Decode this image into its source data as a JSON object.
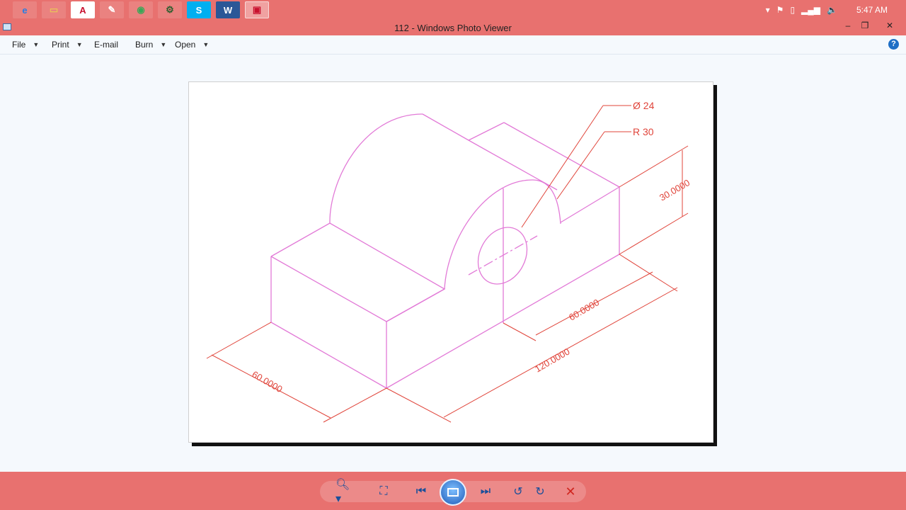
{
  "window": {
    "title": "112 - Windows Photo Viewer"
  },
  "taskbar": {
    "apps": [
      {
        "name": "internet-explorer",
        "glyph": "e"
      },
      {
        "name": "file-explorer",
        "glyph": "▭"
      },
      {
        "name": "autocad",
        "glyph": "A"
      },
      {
        "name": "paint",
        "glyph": "✎"
      },
      {
        "name": "chrome",
        "glyph": "◉"
      },
      {
        "name": "tools",
        "glyph": "⚙"
      },
      {
        "name": "skype",
        "glyph": "S"
      },
      {
        "name": "word",
        "glyph": "W"
      },
      {
        "name": "photo-viewer",
        "glyph": "▣"
      }
    ],
    "tray": {
      "clock": "5:47 AM"
    }
  },
  "menu": {
    "file": "File",
    "print": "Print",
    "email": "E-mail",
    "burn": "Burn",
    "open": "Open",
    "help": "?"
  },
  "drawing": {
    "diameter_label": "Ø 24",
    "radius_label": "R 30",
    "dim_height": "30.0000",
    "dim_depth": "60.0000",
    "dim_inner": "60.0000",
    "dim_length": "120.0000",
    "line_color": "#e27ad7",
    "dim_color": "#e0443a"
  },
  "colors": {
    "accent": "#e8716f",
    "background": "#f5f9fd"
  }
}
